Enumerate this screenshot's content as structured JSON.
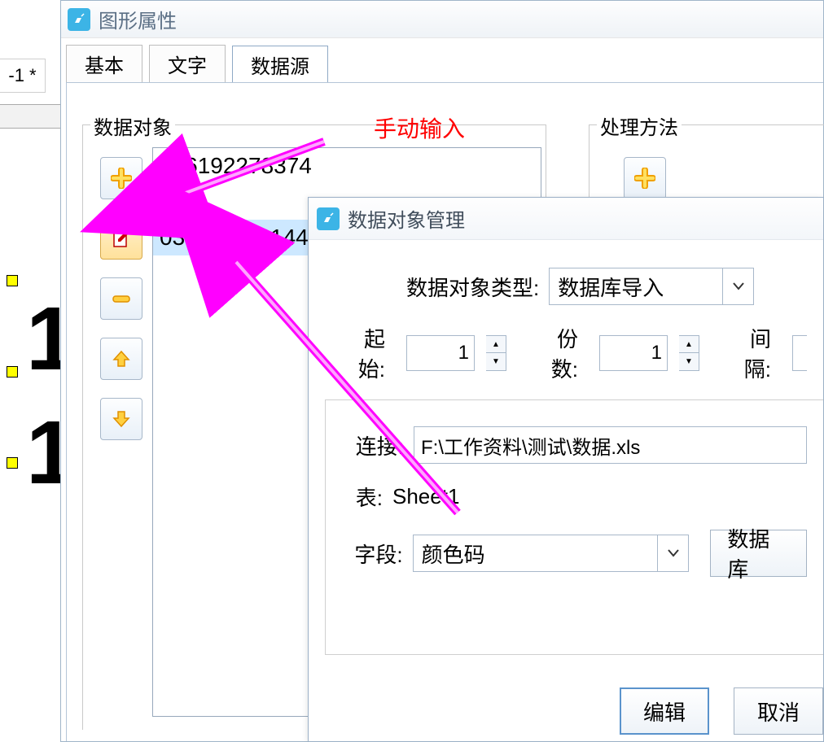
{
  "left_pane": {
    "tab_label": "-1 *"
  },
  "window": {
    "title": "图形属性"
  },
  "tabs": {
    "t1": "基本",
    "t2": "文字",
    "t3": "数据源"
  },
  "group_data_obj": {
    "title": "数据对象",
    "items": {
      "i1": "696192278374",
      "i2": ",",
      "i3": "037816311144"
    }
  },
  "group_proc": {
    "title": "处理方法"
  },
  "annotation": "手动输入",
  "dialog": {
    "title": "数据对象管理",
    "type_label": "数据对象类型:",
    "type_value": "数据库导入",
    "start_label": "起始:",
    "start_value": "1",
    "count_label": "份数:",
    "count_value": "1",
    "interval_label": "间隔:",
    "conn_label": "连接:",
    "conn_value": "F:\\工作资料\\测试\\数据.xls",
    "table_label": "表:",
    "table_value": "Sheet1",
    "field_label": "字段:",
    "field_value": "颜色码",
    "data_btn": "数据库",
    "edit_btn": "编辑",
    "cancel_btn": "取消"
  }
}
